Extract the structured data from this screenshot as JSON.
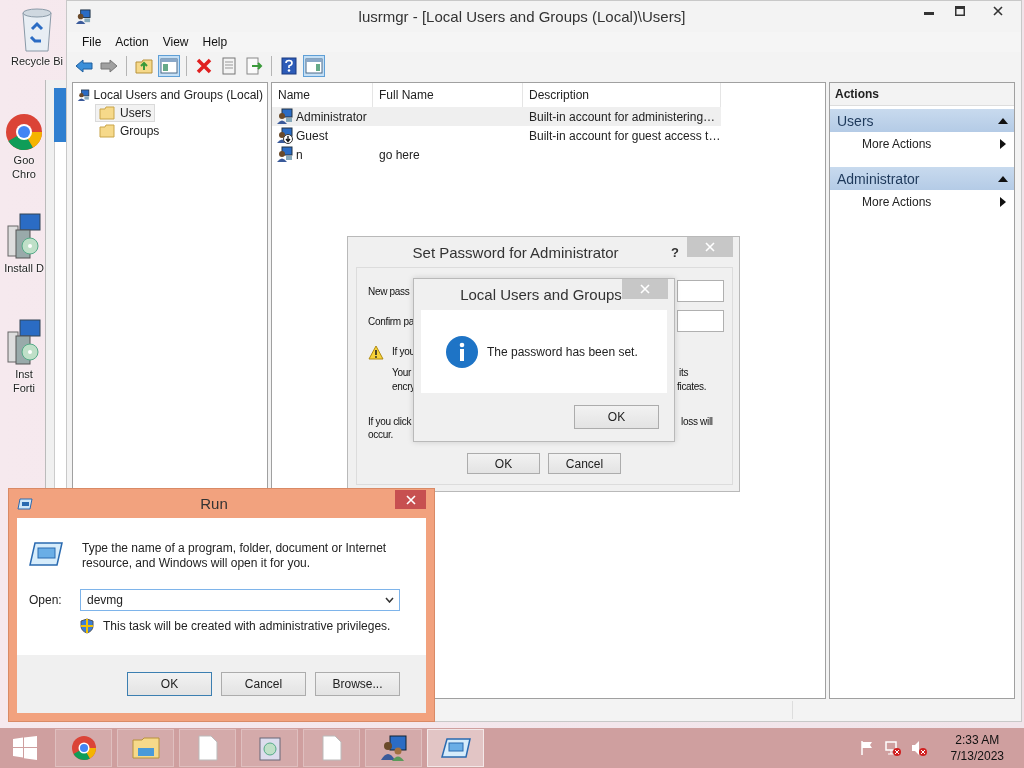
{
  "desktop": {
    "icons": [
      {
        "kind": "recycle",
        "lines": [
          "Recycle Bi"
        ]
      },
      {
        "kind": "chrome",
        "lines": [
          "Goo",
          "Chro"
        ]
      },
      {
        "kind": "installer",
        "lines": [
          "Install D"
        ]
      },
      {
        "kind": "installer",
        "lines": [
          "Inst",
          "Forti"
        ]
      }
    ]
  },
  "main_window": {
    "title": "lusrmgr - [Local Users and Groups (Local)\\Users]",
    "menu": [
      "File",
      "Action",
      "View",
      "Help"
    ],
    "toolbar_groups": [
      [
        {
          "kind": "back",
          "on": false
        },
        {
          "kind": "forward",
          "on": false
        }
      ],
      [
        {
          "kind": "up",
          "on": false
        },
        {
          "kind": "console-tree",
          "on": true
        }
      ],
      [
        {
          "kind": "delete",
          "on": false
        },
        {
          "kind": "properties",
          "on": false
        },
        {
          "kind": "export",
          "on": false
        }
      ],
      [
        {
          "kind": "help",
          "on": false
        },
        {
          "kind": "action-pane",
          "on": true
        }
      ]
    ],
    "tree": {
      "label": "Local Users and Groups (Local)",
      "children": [
        {
          "label": "Users",
          "selected": true
        },
        {
          "label": "Groups",
          "selected": false
        }
      ]
    },
    "list": {
      "columns": [
        "Name",
        "Full Name",
        "Description"
      ],
      "rows": [
        {
          "kind": "user",
          "name": "Administrator",
          "description": "Built-in account for administering…",
          "selected": true
        },
        {
          "kind": "disabled-user",
          "name": "Guest",
          "description": "Built-in account for guest access t…",
          "selected": false
        },
        {
          "kind": "user",
          "name": "n",
          "full_name": "go here",
          "selected": false
        }
      ]
    },
    "actions": {
      "header": "Actions",
      "sections": [
        {
          "title": "Users",
          "expanded": true,
          "items": [
            "More Actions"
          ]
        },
        {
          "title": "Administrator",
          "expanded": true,
          "items": [
            "More Actions"
          ]
        }
      ]
    }
  },
  "set_password_dialog": {
    "title": "Set Password for Administrator",
    "help_button": "?",
    "left_texts": [
      "New pass",
      "Confirm pa",
      "If you",
      "Your",
      "encry",
      "If you click",
      "occur."
    ],
    "right_texts": [
      "its",
      "ficates.",
      "loss will"
    ],
    "buttons": [
      "OK",
      "Cancel"
    ]
  },
  "message_box": {
    "title": "Local Users and Groups",
    "message": "The password has been set.",
    "buttons": [
      "OK"
    ]
  },
  "run_dialog": {
    "title": "Run",
    "description": "Type the name of a program, folder, document or Internet resource, and Windows will open it for you.",
    "open_label": "Open:",
    "value": "devmg",
    "note": "This task will be created with administrative privileges.",
    "buttons": [
      "OK",
      "Cancel",
      "Browse..."
    ]
  },
  "taskbar": {
    "buttons": [
      {
        "kind": "chrome",
        "active": false
      },
      {
        "kind": "explorer",
        "active": false
      },
      {
        "kind": "document",
        "active": false
      },
      {
        "kind": "installer",
        "active": false
      },
      {
        "kind": "document",
        "active": false
      },
      {
        "kind": "users",
        "active": false
      },
      {
        "kind": "run",
        "active": true
      }
    ],
    "tray": [
      {
        "kind": "flag"
      },
      {
        "kind": "network-off"
      },
      {
        "kind": "sound-off"
      }
    ],
    "clock": {
      "time": "2:33 AM",
      "date": "7/13/2023"
    }
  }
}
